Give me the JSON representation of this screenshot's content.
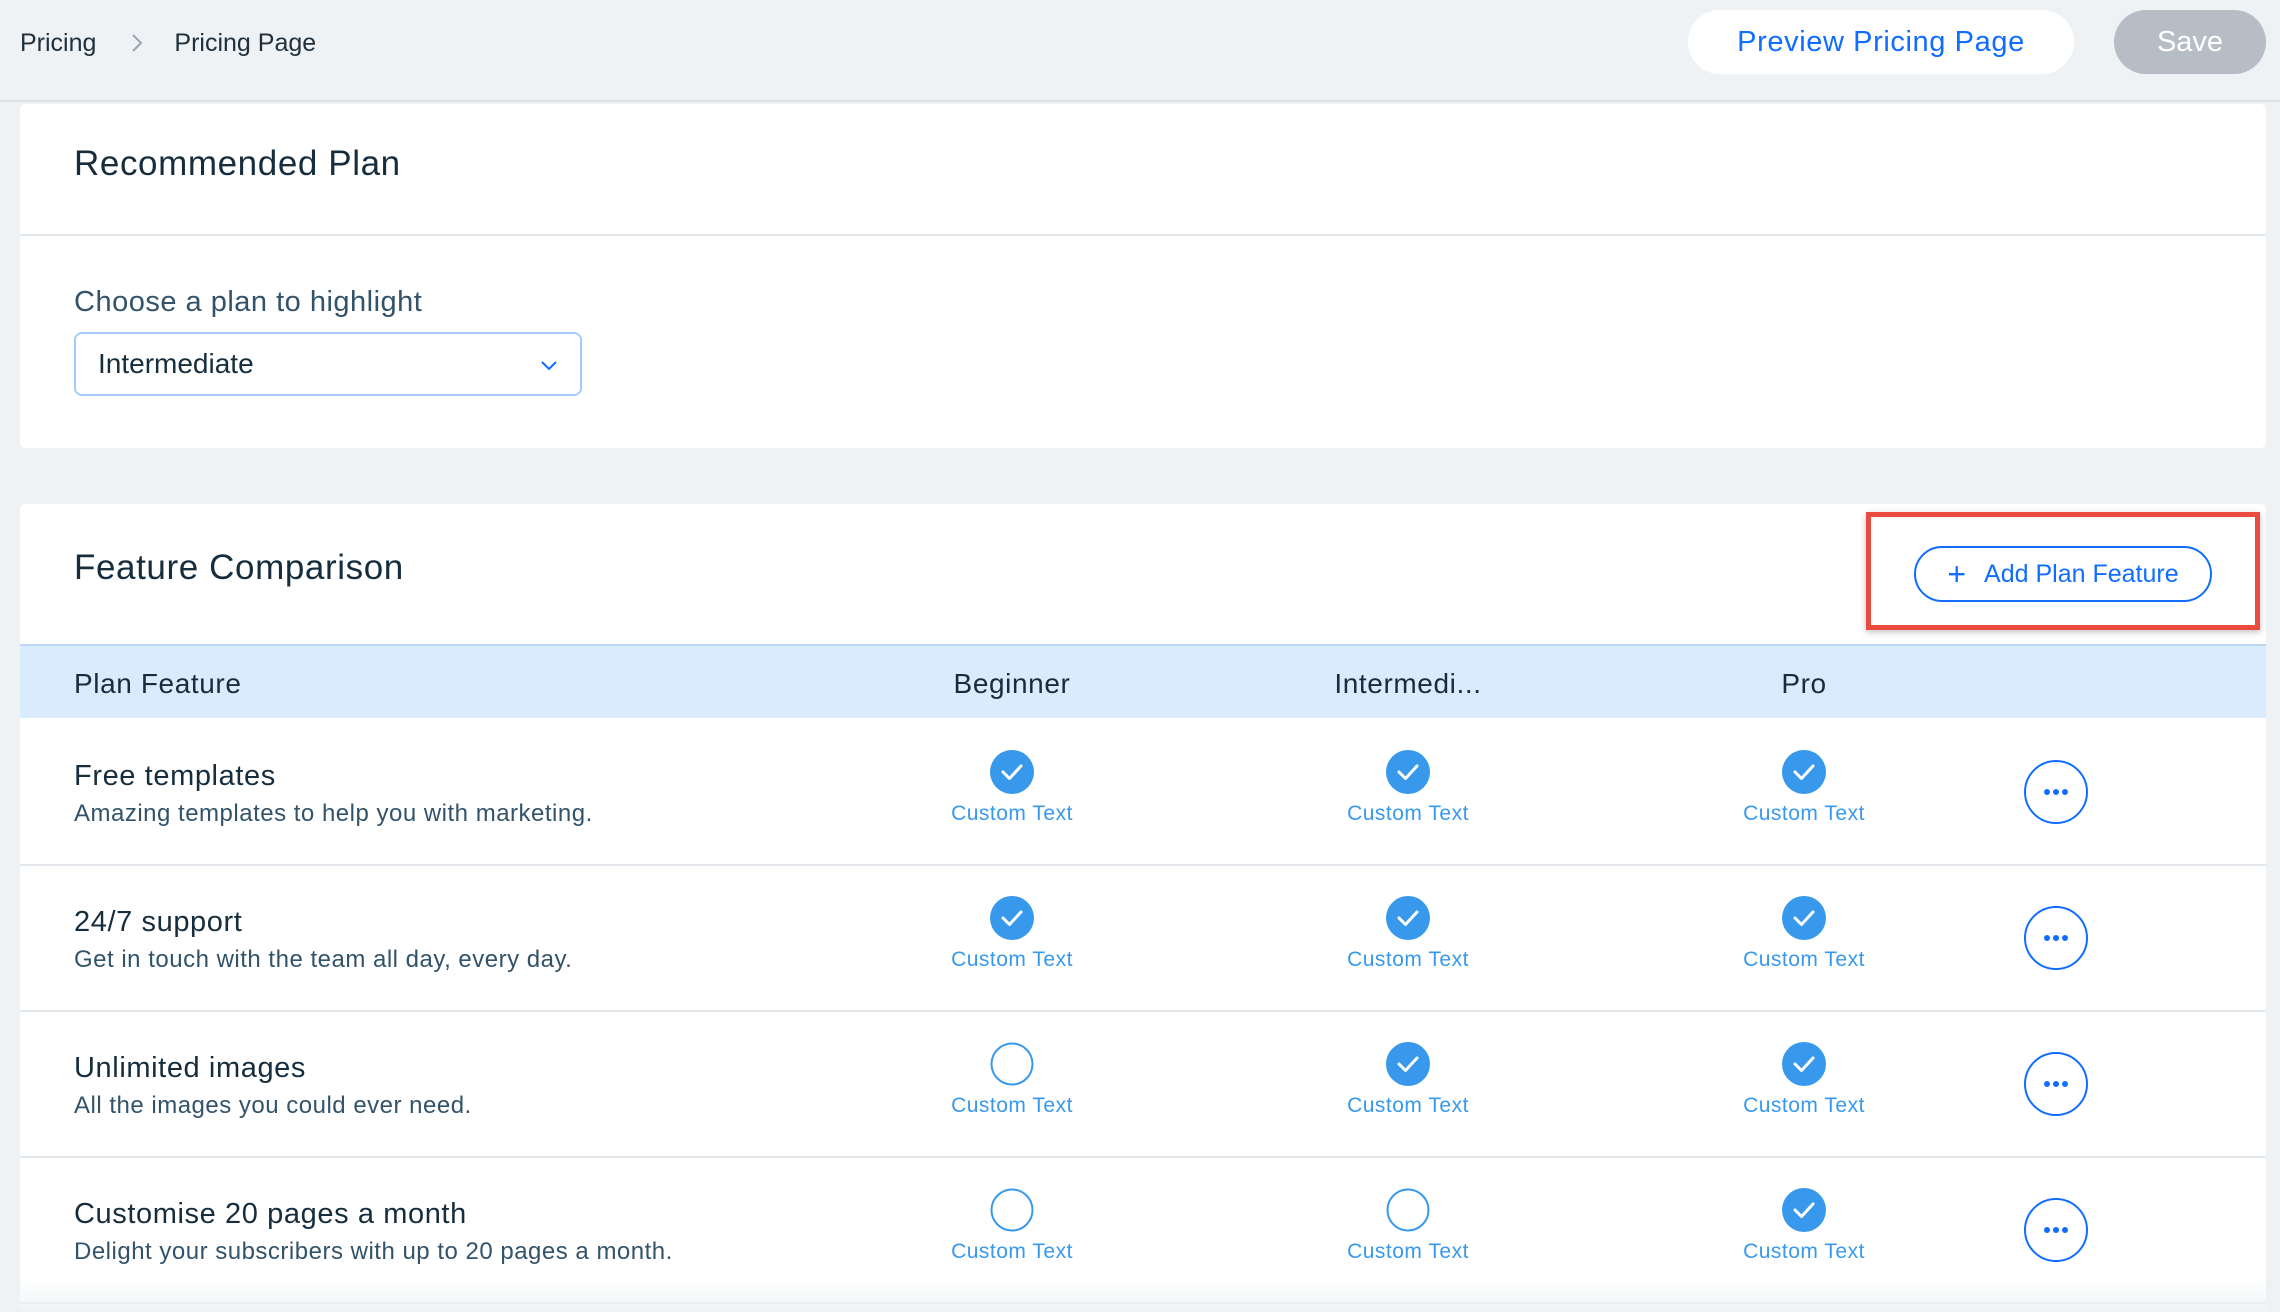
{
  "header": {
    "breadcrumb": [
      "Pricing",
      "Pricing Page"
    ],
    "preview_label": "Preview Pricing Page",
    "save_label": "Save"
  },
  "recommended": {
    "title": "Recommended Plan",
    "field_label": "Choose a plan to highlight",
    "selected_plan": "Intermediate"
  },
  "features": {
    "title": "Feature Comparison",
    "add_label": "Add Plan Feature",
    "columns": [
      "Plan Feature",
      "Beginner",
      "Intermedi...",
      "Pro"
    ],
    "rows": [
      {
        "name": "Free templates",
        "description": "Amazing templates to help you with marketing.",
        "cells": [
          {
            "checked": true,
            "text": "Custom Text"
          },
          {
            "checked": true,
            "text": "Custom Text"
          },
          {
            "checked": true,
            "text": "Custom Text"
          }
        ]
      },
      {
        "name": "24/7 support",
        "description": "Get in touch with the team all day, every day.",
        "cells": [
          {
            "checked": true,
            "text": "Custom Text"
          },
          {
            "checked": true,
            "text": "Custom Text"
          },
          {
            "checked": true,
            "text": "Custom Text"
          }
        ]
      },
      {
        "name": "Unlimited images",
        "description": "All the images you could ever need.",
        "cells": [
          {
            "checked": false,
            "text": "Custom Text"
          },
          {
            "checked": true,
            "text": "Custom Text"
          },
          {
            "checked": true,
            "text": "Custom Text"
          }
        ]
      },
      {
        "name": "Customise 20 pages a month",
        "description": "Delight your subscribers with up to 20 pages a month.",
        "cells": [
          {
            "checked": false,
            "text": "Custom Text"
          },
          {
            "checked": false,
            "text": "Custom Text"
          },
          {
            "checked": true,
            "text": "Custom Text"
          }
        ]
      }
    ]
  },
  "colors": {
    "accent": "#116dff",
    "check_fill": "#3899ec",
    "table_header": "#d9ebfd",
    "highlight_box": "#ea4b3f",
    "save_disabled": "#b6bdc5"
  },
  "icons": {
    "breadcrumb_separator": "chevron-right-icon",
    "dropdown": "chevron-down-icon",
    "add": "plus-icon",
    "row_actions": "more-horizontal-icon",
    "checked": "check-circle-filled-icon",
    "unchecked": "circle-outline-icon"
  }
}
